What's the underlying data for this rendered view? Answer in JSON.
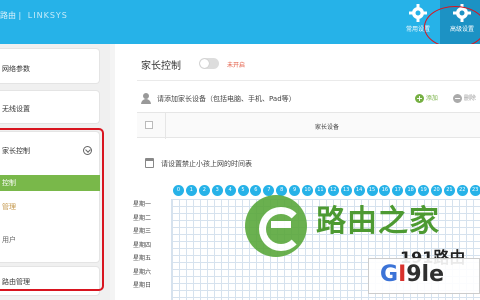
{
  "topbar": {
    "brand_left": "路由 | ",
    "brand_right": "LINKSYS",
    "quick_settings_label": "常用设置",
    "advanced_settings_label": "高级设置"
  },
  "sidebar": {
    "items": [
      {
        "label": "网络参数"
      },
      {
        "label": "无线设置"
      },
      {
        "label": "家长控制"
      },
      {
        "label": "路由管理"
      }
    ],
    "parental_sub": [
      {
        "label": "控制"
      },
      {
        "label": "管理"
      },
      {
        "label": "用户"
      }
    ]
  },
  "main": {
    "title": "家长控制",
    "toggle_status": "未开启",
    "device_prompt": "请添加家长设备（包括电脑、手机、Pad等）",
    "add_label": "添加",
    "delete_label": "删除",
    "table_header": "家长设备",
    "schedule_prompt": "请设置禁止小孩上网的时间表",
    "hours": [
      "0",
      "1",
      "2",
      "3",
      "4",
      "5",
      "6",
      "7",
      "8",
      "9",
      "10",
      "11",
      "12",
      "13",
      "14",
      "15",
      "16",
      "17",
      "18",
      "19",
      "20",
      "21",
      "22",
      "23"
    ],
    "days": [
      "星期一",
      "星期二",
      "星期三",
      "星期四",
      "星期五",
      "星期六",
      "星期日"
    ]
  },
  "watermark": {
    "title": "路由之家",
    "line1": "191路由",
    "line2_a": "G",
    "line2_b": "I",
    "line2_c": "9le"
  },
  "colors": {
    "topbar": "#26b2e8",
    "active_sub": "#79b84a",
    "highlight": "#d8141f",
    "hour_chip": "#26b2e8"
  },
  "icons": [
    "gear-icon",
    "user-icon",
    "calendar-icon",
    "plus-icon",
    "minus-icon",
    "chevron-down-icon"
  ]
}
